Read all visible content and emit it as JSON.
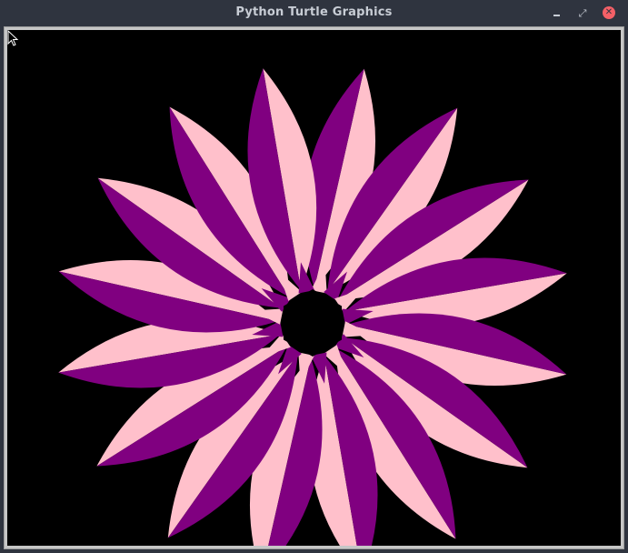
{
  "window": {
    "title": "Python Turtle Graphics",
    "minimize_icon": "minimize-icon",
    "maximize_icon": "restore-icon",
    "close_icon": "close-icon"
  },
  "canvas": {
    "background": "#000000",
    "petal_light": "#ffc0cb",
    "petal_dark": "#800080",
    "center_color": "#000000"
  },
  "colors": {
    "titlebar": "#2f343f",
    "title_text": "#c8cdd5",
    "close_button": "#f46067"
  }
}
